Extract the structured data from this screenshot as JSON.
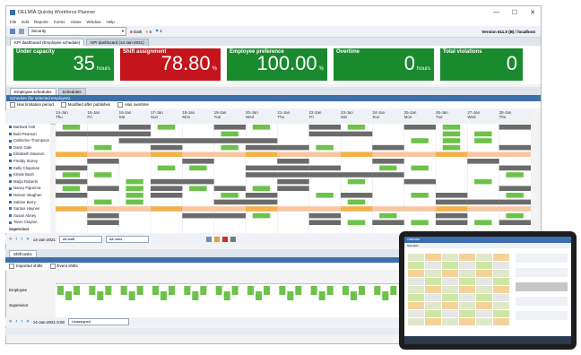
{
  "window": {
    "title": "DELMIA Quintiq Workforce Planner",
    "menu": [
      "File",
      "Edit",
      "Reports",
      "Forms",
      "Views",
      "Window",
      "Help"
    ],
    "controls": [
      "—",
      "☐",
      "✕"
    ]
  },
  "toolbar": {
    "security_select": "Security",
    "badge_dark": "Dark",
    "badge_count_a": "6",
    "badge_count_b": "1",
    "version": "Version 611.0 (B) / localhost"
  },
  "doc_tabs": [
    "KPI dashboard (Employee schedule)",
    "KPI dashboard (14-Jan-2021)"
  ],
  "kpis": [
    {
      "label": "Under capacity",
      "value": "35",
      "unit": "hours",
      "color": "#1a8a2e",
      "width": 112
    },
    {
      "label": "Shift assignment",
      "value": "78.80",
      "unit": "%",
      "color": "#c4151c",
      "width": 112
    },
    {
      "label": "Employee preference",
      "value": "100.00",
      "unit": "%",
      "color": "#1a8a2e",
      "width": 112
    },
    {
      "label": "Overtime",
      "value": "0",
      "unit": "hours",
      "color": "#1a8a2e",
      "width": 112
    },
    {
      "label": "Total violations",
      "value": "0",
      "unit": "",
      "color": "#1a8a2e",
      "width": 92
    }
  ],
  "panel_tabs": [
    "Employee schedules",
    "Schedules"
  ],
  "panel_head": "Schedule (for selected employee)",
  "filters": [
    "Has limitation period",
    "Modified after publishes",
    "Has overtime"
  ],
  "dates": [
    {
      "d": "14-Jan",
      "w": "Thu"
    },
    {
      "d": "15-Jan",
      "w": "Fri"
    },
    {
      "d": "16-Jan",
      "w": "Sat"
    },
    {
      "d": "17-Jan",
      "w": "Sun"
    },
    {
      "d": "18-Jan",
      "w": "Mon"
    },
    {
      "d": "19-Jan",
      "w": "Tue"
    },
    {
      "d": "20-Jan",
      "w": "Wed"
    },
    {
      "d": "21-Jan",
      "w": "Thu"
    },
    {
      "d": "22-Jan",
      "w": "Fri"
    },
    {
      "d": "23-Jan",
      "w": "Sat"
    },
    {
      "d": "24-Jan",
      "w": "Sun"
    },
    {
      "d": "25-Jan",
      "w": "Mon"
    },
    {
      "d": "26-Jan",
      "w": "Tue"
    },
    {
      "d": "27-Jan",
      "w": "Wed"
    },
    {
      "d": "28-Jan",
      "w": "Thu"
    }
  ],
  "employees": [
    "Barbara Holt",
    "Bold Pearson",
    "Catherine Thompson",
    "Darin Gale",
    "Elizabeth Dawson",
    "Freddy Storey",
    "Kelly Chapman",
    "Kristie Bush",
    "Marja Roberts",
    "Nancy Figueroa",
    "Nelson Vaughan",
    "Sabine Berry",
    "Santos Haynes",
    "Susan Abney",
    "Taree Clayton"
  ],
  "supervisor_label": "Supervisor",
  "nav": {
    "date": "14-Jan-2021",
    "staff": "All staff",
    "roles": "All roles"
  },
  "shift_panel": {
    "tab": "Shift tasks",
    "checks": [
      "Imported shifts",
      "Event shifts"
    ],
    "rows": [
      "Employee",
      "Supervisor"
    ],
    "date": "14-Jan-2021 5:00",
    "select": "Unassigned"
  },
  "status": "14-Jan-2021",
  "tablet": {
    "title": "Calendar",
    "subtitle": "Schedule"
  }
}
